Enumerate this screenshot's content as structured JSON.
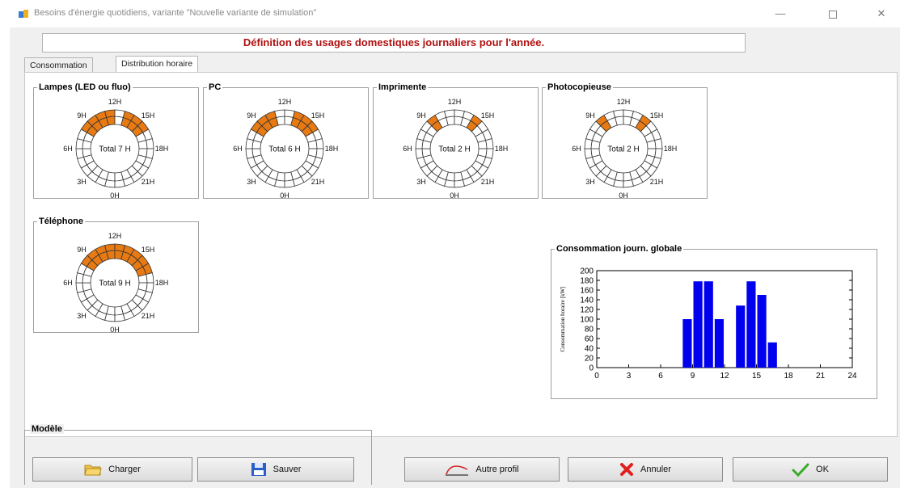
{
  "window": {
    "title": "Besoins d'énergie quotidiens, variante \"Nouvelle variante de simulation\"",
    "minimize_glyph": "—",
    "close_glyph": "✕"
  },
  "header": {
    "title": "Définition des usages domestiques journaliers pour l'année."
  },
  "tabs": [
    {
      "label": "Consommation",
      "active": false
    },
    {
      "label": "Distribution horaire",
      "active": true
    }
  ],
  "clocks": [
    {
      "name": "Lampes (LED ou fluo)",
      "total": "Total 7 H",
      "hours_on": [
        8,
        9,
        10,
        11,
        13,
        14,
        15
      ]
    },
    {
      "name": "PC",
      "total": "Total 6 H",
      "hours_on": [
        8,
        9,
        10,
        13,
        14,
        15
      ]
    },
    {
      "name": "Imprimente",
      "total": "Total 2 H",
      "hours_on": [
        9,
        14
      ]
    },
    {
      "name": "Photocopieuse",
      "total": "Total 2 H",
      "hours_on": [
        9,
        14
      ]
    },
    {
      "name": "Téléphone",
      "total": "Total 9 H",
      "hours_on": [
        8,
        9,
        10,
        11,
        12,
        13,
        14,
        15,
        16
      ]
    }
  ],
  "clock_hour_labels": {
    "h0": "0H",
    "h3": "3H",
    "h6": "6H",
    "h9": "9H",
    "h12": "12H",
    "h15": "15H",
    "h18": "18H",
    "h21": "21H"
  },
  "chart_data": {
    "type": "bar",
    "title": "Consommation journ. globale",
    "ylabel": "Consommation horaire [kW]",
    "xlabel": "",
    "x": [
      8,
      9,
      10,
      11,
      13,
      14,
      15,
      16
    ],
    "values": [
      100,
      178,
      178,
      100,
      128,
      178,
      150,
      52
    ],
    "xlim": [
      0,
      24
    ],
    "ylim": [
      0,
      200
    ],
    "xticks": [
      0,
      3,
      6,
      9,
      12,
      15,
      18,
      21,
      24
    ],
    "yticks": [
      0,
      20,
      40,
      60,
      80,
      100,
      120,
      140,
      160,
      180,
      200
    ],
    "color": "#0000ee"
  },
  "model": {
    "label": "Modèle"
  },
  "buttons": {
    "charger": "Charger",
    "sauver": "Sauver",
    "autre_profil": "Autre profil",
    "annuler": "Annuler",
    "ok": "OK"
  },
  "colors": {
    "on": "#e87a14",
    "off": "#ffffff",
    "header_text": "#b01010",
    "bar": "#0000ee"
  }
}
